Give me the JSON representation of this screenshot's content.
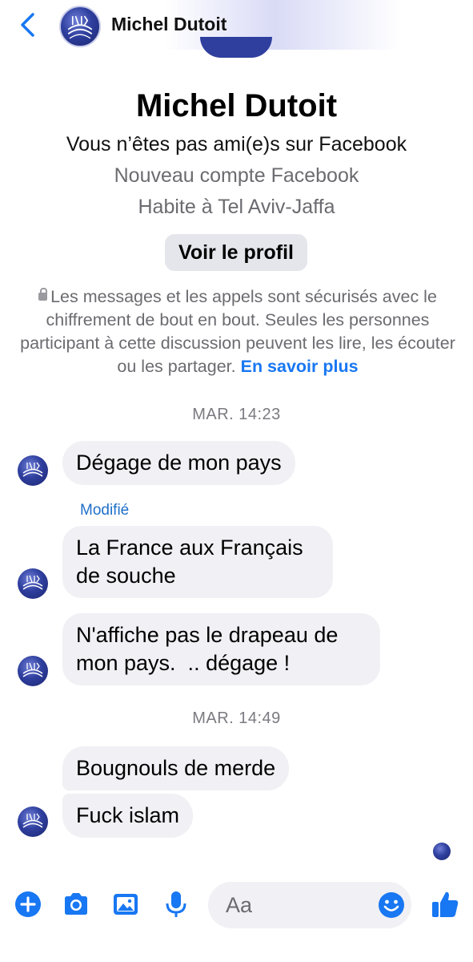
{
  "colors": {
    "accent": "#1877f2",
    "bubble_background": "#f0f0f5",
    "secondary_text": "#6b6b70",
    "avatar_blue": "#2f3f9e"
  },
  "header": {
    "back_icon": "chevron-left-icon",
    "contact_name": "Michel Dutoit"
  },
  "profile": {
    "name": "Michel Dutoit",
    "friend_status": "Vous n’êtes pas ami(e)s sur Facebook",
    "account_note": "Nouveau compte Facebook",
    "location": "Habite à Tel Aviv-Jaffa",
    "view_profile_label": "Voir le profil"
  },
  "encryption_notice": {
    "icon": "lock-icon",
    "text": "Les messages et les appels sont sécurisés avec le chiffrement de bout en bout. Seules les personnes participant à cette discussion peuvent les lire, les écouter ou les partager.",
    "link": "En savoir plus"
  },
  "conversation": {
    "timestamp_1": "MAR. 14:23",
    "timestamp_2": "MAR. 14:49",
    "edited_label": "Modifié",
    "messages": [
      {
        "lines": [
          "Dégage de mon pays"
        ]
      },
      {
        "lines": [
          "La France aux Français",
          "de souche"
        ]
      },
      {
        "lines": [
          "N'affiche pas le drapeau de",
          "mon pays.  .. dégage !"
        ]
      },
      {
        "lines": [
          "Bougnouls de merde"
        ]
      },
      {
        "lines": [
          "Fuck islam"
        ]
      }
    ]
  },
  "composer": {
    "icons": [
      "plus-circle-icon",
      "camera-icon",
      "image-icon",
      "microphone-icon",
      "emoji-icon",
      "thumbs-up-icon"
    ],
    "placeholder": "Aa"
  }
}
